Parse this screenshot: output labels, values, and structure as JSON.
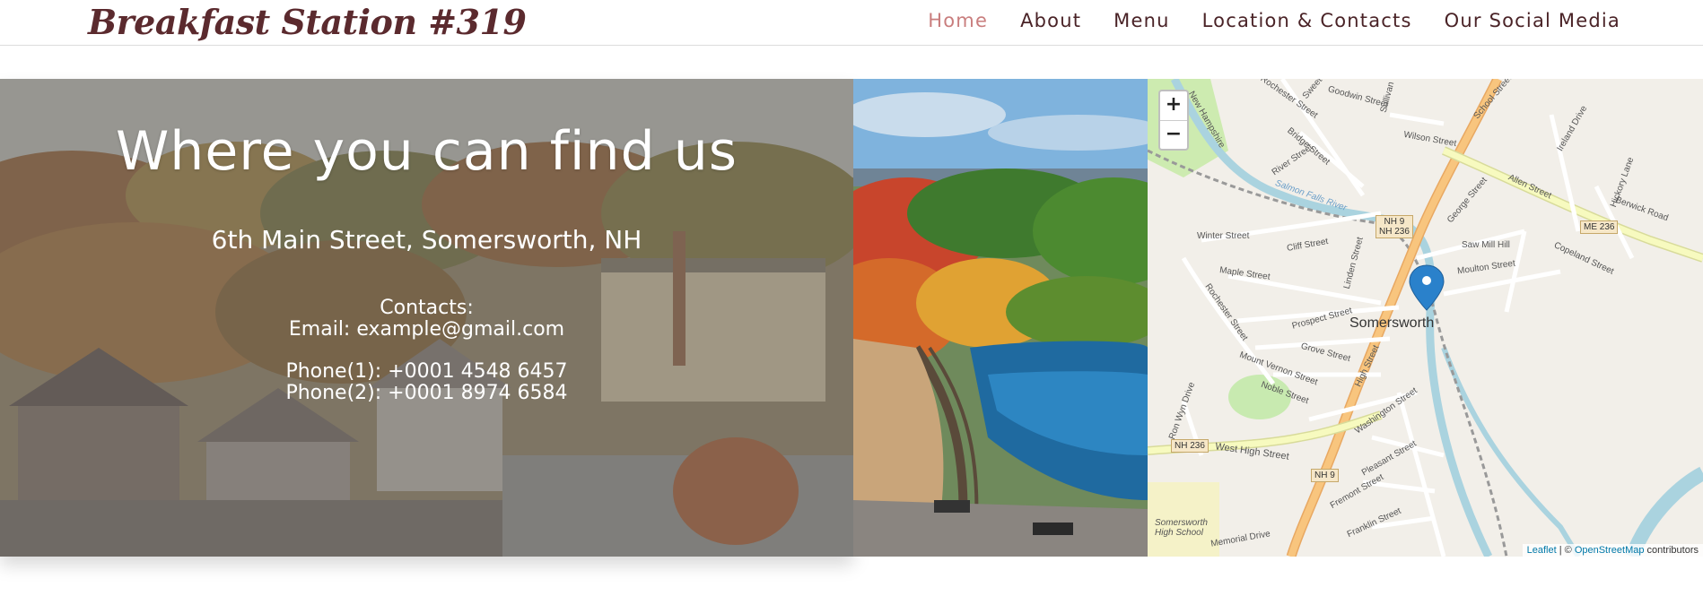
{
  "header": {
    "logo": "Breakfast Station #319",
    "nav": [
      "Home",
      "About",
      "Menu",
      "Location & Contacts",
      "Our Social Media"
    ]
  },
  "location": {
    "title": "Where you can find us",
    "address": "6th Main Street, Somersworth, NH",
    "contacts_label": "Contacts:",
    "email": "Email: example@gmail.com",
    "phone1": "Phone(1): +0001 4548 6457",
    "phone2": "Phone(2): +0001 8974 6584"
  },
  "map": {
    "zoom_in": "+",
    "zoom_out": "−",
    "city": "Somersworth",
    "attribution_leaflet": "Leaflet",
    "attribution_sep": " | © ",
    "attribution_osm": "OpenStreetMap",
    "attribution_tail": " contributors",
    "shield_nh9_236": "NH 9\nNH 236",
    "shield_me236": "ME 236",
    "shield_nh236": "NH 236",
    "shield_nh9": "NH 9",
    "labels": [
      "Rochester Street",
      "Sweet",
      "Goodwin Street",
      "Sullivan",
      "School Street",
      "New Hampshire",
      "Bridge Street",
      "Wilson Street",
      "River Street",
      "Ireland Drive",
      "Allen Street",
      "Salmon Falls River",
      "Hickory Lane",
      "George Street",
      "Berwick Road",
      "Winter Street",
      "Cliff Street",
      "Saw Mill Hill",
      "Maple Street",
      "Linden Street",
      "Moulton Street",
      "Copeland Street",
      "Rochester Street",
      "Prospect Street",
      "Grove Street",
      "Mount Vernon Street",
      "High Street",
      "Noble Street",
      "Washington Street",
      "Ron Wyn Drive",
      "West High Street",
      "Pleasant Street",
      "Fremont Street",
      "Franklin Street",
      "Somersworth High School",
      "Memorial Drive"
    ]
  },
  "colors": {
    "brand": "#5b2a2e",
    "nav_active": "#c97e7e",
    "map_bg": "#f2efe9",
    "major_road": "#f8c57e",
    "secondary_road": "#f7fabf",
    "river": "#aad3df",
    "marker": "#2a81cb"
  }
}
